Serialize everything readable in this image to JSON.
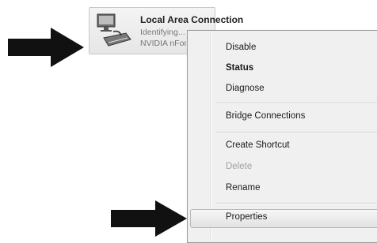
{
  "connection": {
    "title": "Local Area Connection",
    "line1": "Identifying...",
    "line2": "NVIDIA nForce",
    "icon": "network-adapter-icon"
  },
  "context_menu": {
    "items": [
      {
        "label": "Disable",
        "bold": false,
        "disabled": false
      },
      {
        "label": "Status",
        "bold": true,
        "disabled": false
      },
      {
        "label": "Diagnose",
        "bold": false,
        "disabled": false
      },
      {
        "label": "Bridge Connections",
        "bold": false,
        "disabled": false
      },
      {
        "label": "Create Shortcut",
        "bold": false,
        "disabled": false
      },
      {
        "label": "Delete",
        "bold": false,
        "disabled": true
      },
      {
        "label": "Rename",
        "bold": false,
        "disabled": false
      },
      {
        "label": "Properties",
        "bold": false,
        "disabled": false,
        "highlighted": true
      }
    ]
  },
  "annotations": {
    "arrow_color": "#111111",
    "arrows": [
      "pointer-arrow-icon",
      "pointer-arrow-icon"
    ]
  }
}
